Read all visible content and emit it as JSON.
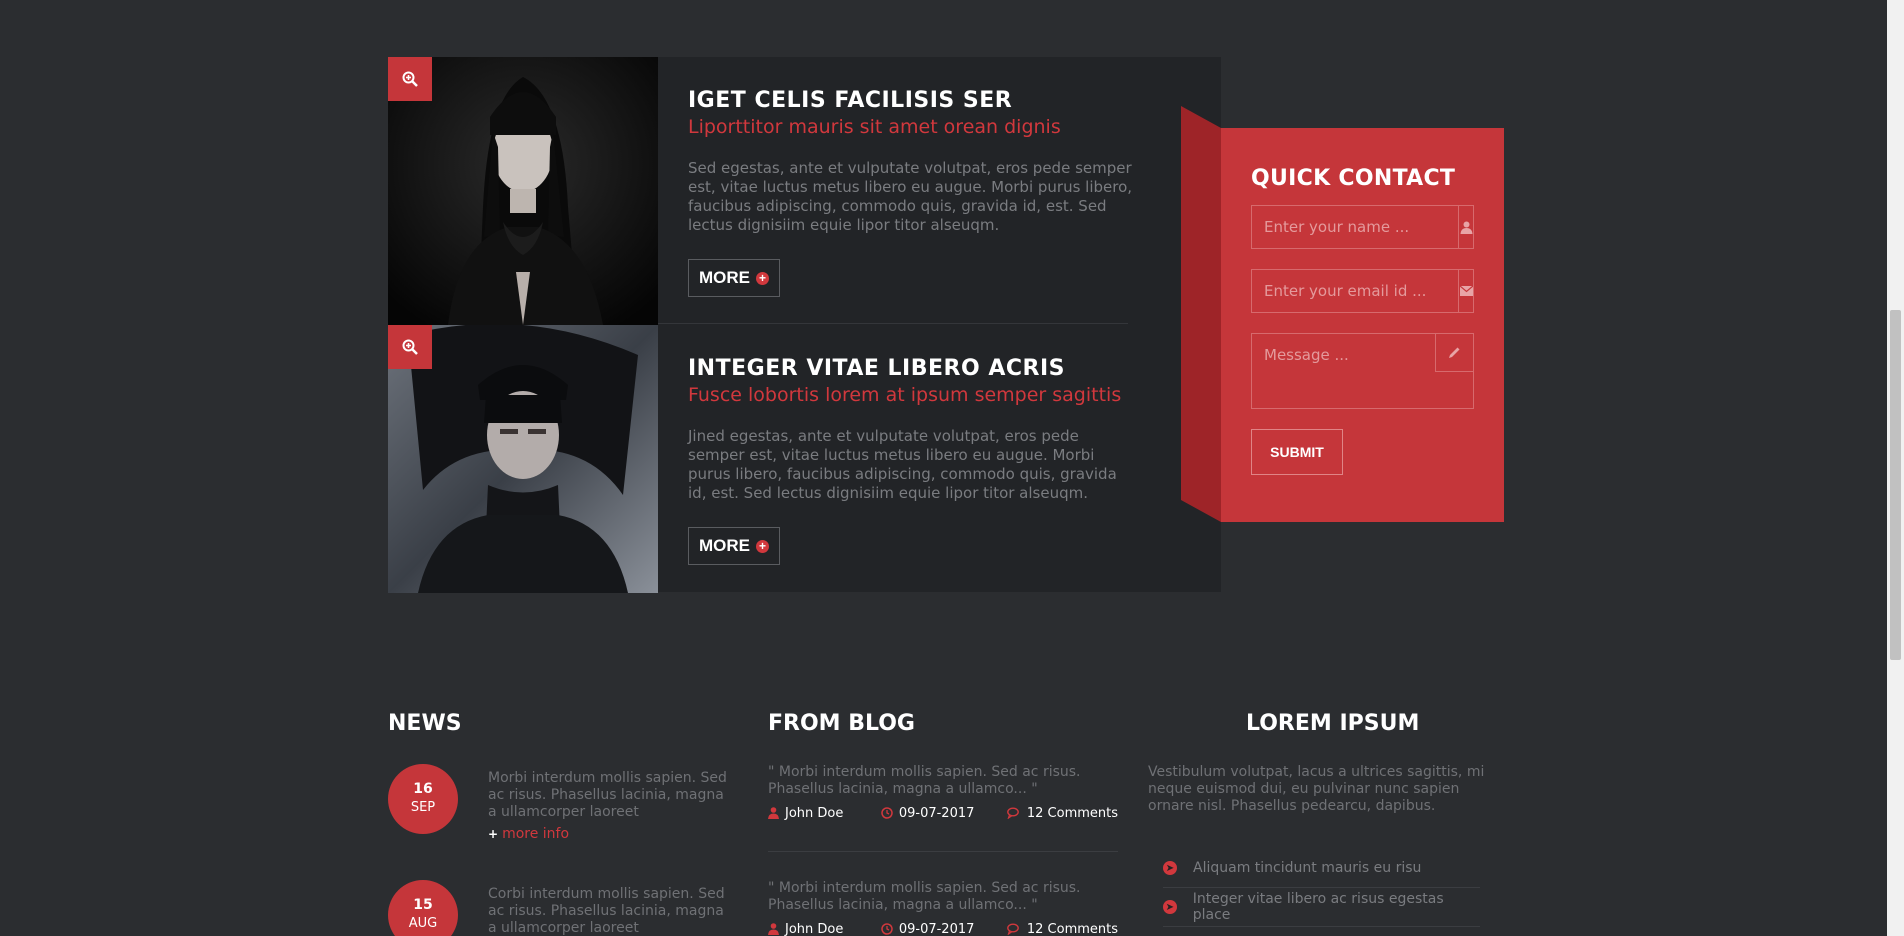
{
  "features": [
    {
      "title": "IGET CELIS FACILISIS SER",
      "subtitle": "Liporttitor mauris sit amet orean dignis",
      "text": "Sed egestas, ante et vulputate volutpat, eros pede semper est, vitae luctus metus libero eu augue. Morbi purus libero, faucibus adipiscing, commodo quis, gravida id, est. Sed lectus dignisiim equie lipor titor alseuqm.",
      "more_label": "MORE"
    },
    {
      "title": "INTEGER VITAE LIBERO ACRIS",
      "subtitle": "Fusce lobortis lorem at ipsum semper sagittis",
      "text": "Jined egestas, ante et vulputate volutpat, eros pede semper est, vitae luctus metus libero eu augue. Morbi purus libero, faucibus adipiscing, commodo quis, gravida id, est. Sed lectus dignisiim equie lipor titor alseuqm.",
      "more_label": "MORE"
    }
  ],
  "quick_contact": {
    "title": "QUICK CONTACT",
    "name_placeholder": "Enter your name ...",
    "email_placeholder": "Enter your email id ...",
    "message_placeholder": "Message ...",
    "submit_label": "SUBMIT"
  },
  "news": {
    "title": "NEWS",
    "items": [
      {
        "day": "16",
        "month": "SEP",
        "text": "Morbi interdum mollis sapien. Sed ac risus. Phasellus lacinia, magna a ullamcorper laoreet",
        "more": "more info"
      },
      {
        "day": "15",
        "month": "AUG",
        "text": "Corbi interdum mollis sapien. Sed ac risus. Phasellus lacinia, magna a ullamcorper laoreet"
      }
    ]
  },
  "blog": {
    "title": "FROM BLOG",
    "items": [
      {
        "text": "\" Morbi interdum mollis sapien. Sed ac risus. Phasellus lacinia, magna a ullamco... \"",
        "author": "John Doe",
        "date": "09-07-2017",
        "comments": "12 Comments"
      },
      {
        "text": "\" Morbi interdum mollis sapien. Sed ac risus. Phasellus lacinia, magna a ullamco... \"",
        "author": "John Doe",
        "date": "09-07-2017",
        "comments": "12 Comments"
      }
    ]
  },
  "lorem": {
    "title": "LOREM IPSUM",
    "text": "Vestibulum volutpat, lacus a ultrices sagittis, mi neque euismod dui, eu pulvinar nunc sapien ornare nisl. Phasellus pedearcu, dapibus.",
    "links": [
      "Aliquam tincidunt mauris eu risu",
      "Integer vitae libero ac risus egestas place"
    ]
  },
  "colors": {
    "accent": "#c5363a",
    "background": "#2b2d30",
    "panel": "#222427"
  },
  "icons": [
    "zoom-in-icon",
    "user-icon",
    "envelope-icon",
    "pencil-icon",
    "plus-circle-icon",
    "clock-icon",
    "comments-icon",
    "arrow-circle-right-icon"
  ]
}
